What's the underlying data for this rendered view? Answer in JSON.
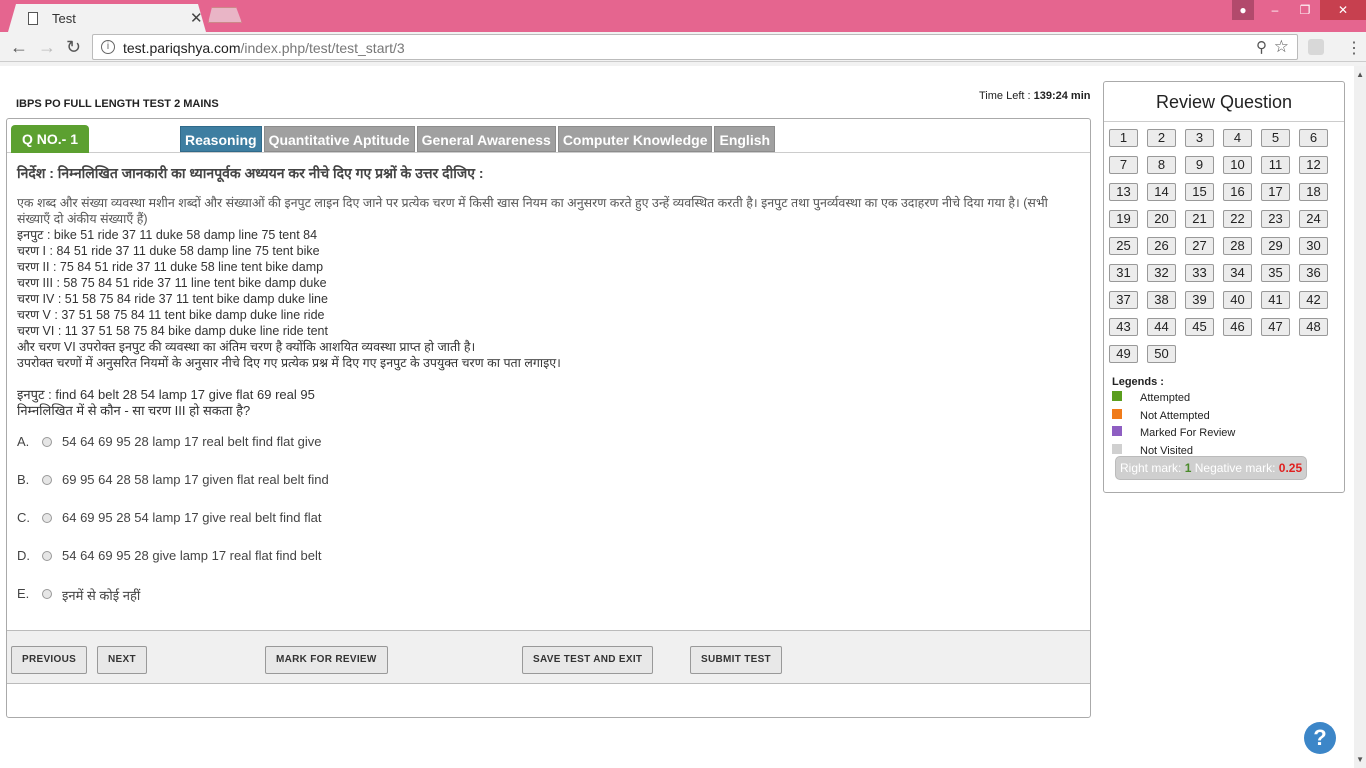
{
  "browser": {
    "tab_title": "Test",
    "url_host": "test.pariqshya.com",
    "url_path": "/index.php/test/test_start/3"
  },
  "header": {
    "test_title": "IBPS PO FULL LENGTH TEST 2 MAINS",
    "time_left_label": "Time Left :",
    "time_left_value": "139:24 min"
  },
  "question": {
    "number_label": "Q NO.- 1",
    "sections": [
      "Reasoning",
      "Quantitative Aptitude",
      "General Awareness",
      "Computer Knowledge",
      "English"
    ],
    "active_section": "Reasoning",
    "instruction": "निर्देश  : निम्नलिखित जानकारी का ध्यानपूर्वक अध्ययन कर नीचे दिए गए प्रश्नों के उत्तर दीजिए :",
    "passage": "एक शब्द और संख्या व्यवस्था मशीन शब्दों और संख्याओं की इनपुट लाइन दिए जाने पर प्रत्येक चरण में किसी खास नियम का अनुसरण करते हुए उन्हें व्यवस्थित करती है। इनपुट तथा पुनर्व्यवस्था का एक उदाहरण नीचे दिया गया है। (सभी संख्याएँ दो अंकीय संख्याएँ हैं)",
    "lines": [
      "इनपुट : bike 51 ride 37 11 duke 58 damp line 75 tent 84",
      "चरण I : 84 51 ride 37 11 duke 58 damp line 75 tent bike",
      "चरण II : 75 84 51 ride 37 11 duke 58 line tent bike damp",
      "चरण III : 58 75 84 51 ride 37 11 line tent bike damp duke",
      "चरण IV : 51 58 75 84 ride 37 11 tent bike damp duke line",
      "चरण V : 37 51 58 75 84 11 tent bike damp duke line ride",
      "चरण VI : 11 37 51 58 75 84 bike damp duke line ride tent",
      "और चरण VI उपरोक्त इनपुट की व्यवस्था का अंतिम चरण है क्योंकि आशयित व्यवस्था प्राप्त हो जाती है।",
      "उपरोक्त चरणों में अनुसरित नियमों के अनुसार नीचे दिए गए प्रत्येक प्रश्न में दिए गए इनपुट के उपयुक्त चरण का पता लगाइए।"
    ],
    "input_line": "इनपुट : find 64 belt 28 54 lamp 17 give flat 69 real 95",
    "question_text": "निम्नलिखित में से कौन - सा चरण III हो सकता है?",
    "options": [
      {
        "letter": "A.",
        "text": "54 64 69 95 28 lamp 17 real belt find flat give"
      },
      {
        "letter": "B.",
        "text": "69 95 64 28 58 lamp 17 given flat real belt find"
      },
      {
        "letter": "C.",
        "text": "64 69 95 28 54 lamp 17 give real belt find flat"
      },
      {
        "letter": "D.",
        "text": "54 64 69 95 28 give lamp 17 real flat find belt"
      },
      {
        "letter": "E.",
        "text": "इनमें से कोई नहीं"
      }
    ]
  },
  "footer": {
    "previous": "PREVIOUS",
    "next": "NEXT",
    "mark_for_review": "MARK FOR REVIEW",
    "save_and_exit": "SAVE TEST AND EXIT",
    "submit": "SUBMIT TEST"
  },
  "review": {
    "title": "Review Question",
    "questions": [
      "1",
      "2",
      "3",
      "4",
      "5",
      "6",
      "7",
      "8",
      "9",
      "10",
      "11",
      "12",
      "13",
      "14",
      "15",
      "16",
      "17",
      "18",
      "19",
      "20",
      "21",
      "22",
      "23",
      "24",
      "25",
      "26",
      "27",
      "28",
      "29",
      "30",
      "31",
      "32",
      "33",
      "34",
      "35",
      "36",
      "37",
      "38",
      "39",
      "40",
      "41",
      "42",
      "43",
      "44",
      "45",
      "46",
      "47",
      "48",
      "49",
      "50"
    ],
    "legends_title": "Legends :",
    "legends": [
      {
        "label": "Attempted",
        "color": "#5b9e1e"
      },
      {
        "label": "Not Attempted",
        "color": "#f07b1a"
      },
      {
        "label": "Marked For Review",
        "color": "#8e5ec2"
      },
      {
        "label": "Not Visited",
        "color": "#d0d0d0"
      }
    ],
    "right_mark_label": "Right mark:",
    "right_mark_value": "1",
    "negative_mark_label": "Negative mark:",
    "negative_mark_value": "0.25"
  },
  "help": {
    "label": "?"
  }
}
